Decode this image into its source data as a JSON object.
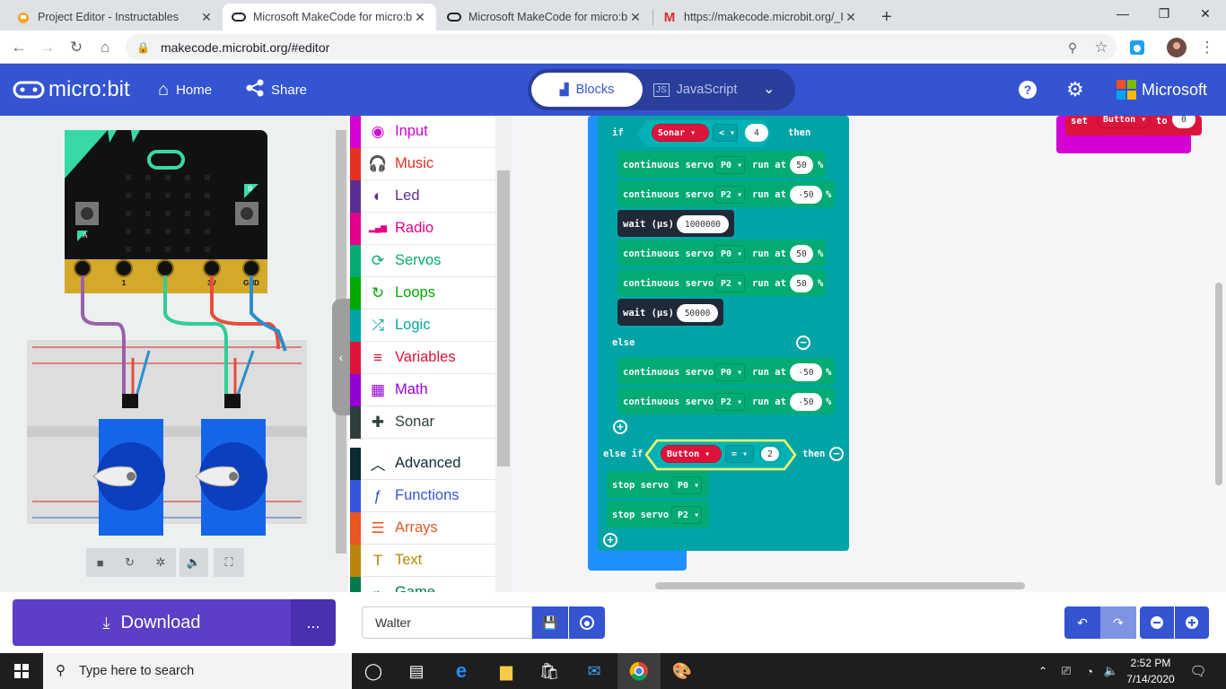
{
  "browser": {
    "tabs": [
      {
        "title": "Project Editor - Instructables",
        "icon": "instructables-robot-icon",
        "active": false
      },
      {
        "title": "Microsoft MakeCode for micro:bi",
        "icon": "microbit-icon",
        "active": true
      },
      {
        "title": "Microsoft MakeCode for micro:bi",
        "icon": "microbit-icon",
        "active": false
      },
      {
        "title": "https://makecode.microbit.org/_I",
        "icon": "gmail-icon",
        "active": false
      }
    ],
    "new_tab_label": "+",
    "url": "makecode.microbit.org/#editor"
  },
  "header": {
    "logo": "micro:bit",
    "home_label": "Home",
    "share_label": "Share",
    "blocks_label": "Blocks",
    "javascript_label": "JavaScript",
    "brand": "Microsoft"
  },
  "simulator": {
    "pin_labels": [
      "0",
      "1",
      "2",
      "3V",
      "GND"
    ],
    "button_a": "A",
    "button_b": "B"
  },
  "toolbox": {
    "categories": [
      {
        "label": "Input",
        "color": "#d400d4",
        "icon": "input-icon"
      },
      {
        "label": "Music",
        "color": "#e63022",
        "icon": "headphones-icon"
      },
      {
        "label": "Led",
        "color": "#5c2d91",
        "icon": "toggle-icon"
      },
      {
        "label": "Radio",
        "color": "#e3008c",
        "icon": "signal-icon"
      },
      {
        "label": "Servos",
        "color": "#03aa74",
        "icon": "refresh-icon"
      },
      {
        "label": "Loops",
        "color": "#00aa00",
        "icon": "loop-icon"
      },
      {
        "label": "Logic",
        "color": "#00a4a6",
        "icon": "shuffle-icon"
      },
      {
        "label": "Variables",
        "color": "#dc143c",
        "icon": "list-icon"
      },
      {
        "label": "Math",
        "color": "#9400d3",
        "icon": "calculator-icon"
      },
      {
        "label": "Sonar",
        "color": "#2e3e3f",
        "icon": "puzzle-icon"
      },
      {
        "label": "Advanced",
        "color": "#0b2b31",
        "icon": "chevron-up-icon"
      },
      {
        "label": "Functions",
        "color": "#3455db",
        "icon": "function-icon"
      },
      {
        "label": "Arrays",
        "color": "#e65722",
        "icon": "arrays-icon"
      },
      {
        "label": "Text",
        "color": "#b8860b",
        "icon": "text-icon"
      },
      {
        "label": "Game",
        "color": "#007a4b",
        "icon": "game-icon"
      }
    ]
  },
  "code": {
    "if_label": "if",
    "then_label": "then",
    "else_label": "else",
    "else_if_label": "else if",
    "sonar_var": "Sonar",
    "lt_op": "<",
    "sonar_threshold": "4",
    "servo_cmd": "continuous servo",
    "run_at": "run at",
    "percent": "%",
    "wait_label": "wait (µs)",
    "pin_p0": "P0",
    "pin_p2": "P2",
    "speeds": [
      "50",
      "-50",
      "50",
      "50",
      "-50",
      "-50"
    ],
    "waits": [
      "1000000",
      "50000"
    ],
    "button_var": "Button",
    "eq_op": "=",
    "button_value": "2",
    "stop_servo": "stop servo",
    "set_label": "set",
    "to_label": "to",
    "set_value": "0"
  },
  "bottom": {
    "download_label": "Download",
    "more_label": "...",
    "project_name": "Walter"
  },
  "taskbar": {
    "search_placeholder": "Type here to search",
    "time": "2:52 PM",
    "date": "7/14/2020"
  }
}
